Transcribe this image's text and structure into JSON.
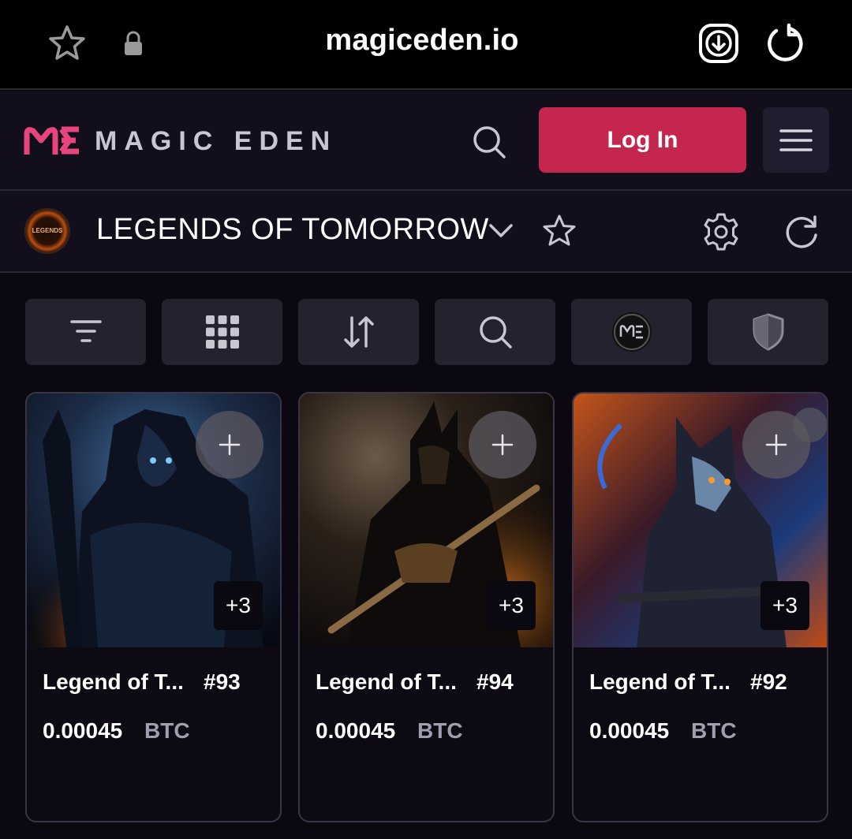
{
  "browser": {
    "url": "magiceden.io",
    "icons": [
      "star-icon",
      "lock-icon",
      "download-icon",
      "reload-icon"
    ]
  },
  "header": {
    "logo_text": "MAGIC EDEN",
    "login_label": "Log In",
    "icons": [
      "search-icon",
      "menu-icon"
    ],
    "accent_color": "#c5264d",
    "logo_color": "#e8457e"
  },
  "collection": {
    "name": "LEGENDS OF TOMORROW",
    "avatar_text": "LEGENDS",
    "icons": [
      "chevron-down-icon",
      "star-icon",
      "gear-icon",
      "refresh-icon"
    ]
  },
  "toolbar": {
    "buttons": [
      "filter-icon",
      "grid-icon",
      "sort-icon",
      "search-icon",
      "me-coin-icon",
      "shield-icon"
    ]
  },
  "cards": [
    {
      "name": "Legend of T...",
      "number": "#93",
      "price": "0.00045",
      "currency": "BTC",
      "extra": "+3"
    },
    {
      "name": "Legend of T...",
      "number": "#94",
      "price": "0.00045",
      "currency": "BTC",
      "extra": "+3"
    },
    {
      "name": "Legend of T...",
      "number": "#92",
      "price": "0.00045",
      "currency": "BTC",
      "extra": "+3"
    }
  ]
}
